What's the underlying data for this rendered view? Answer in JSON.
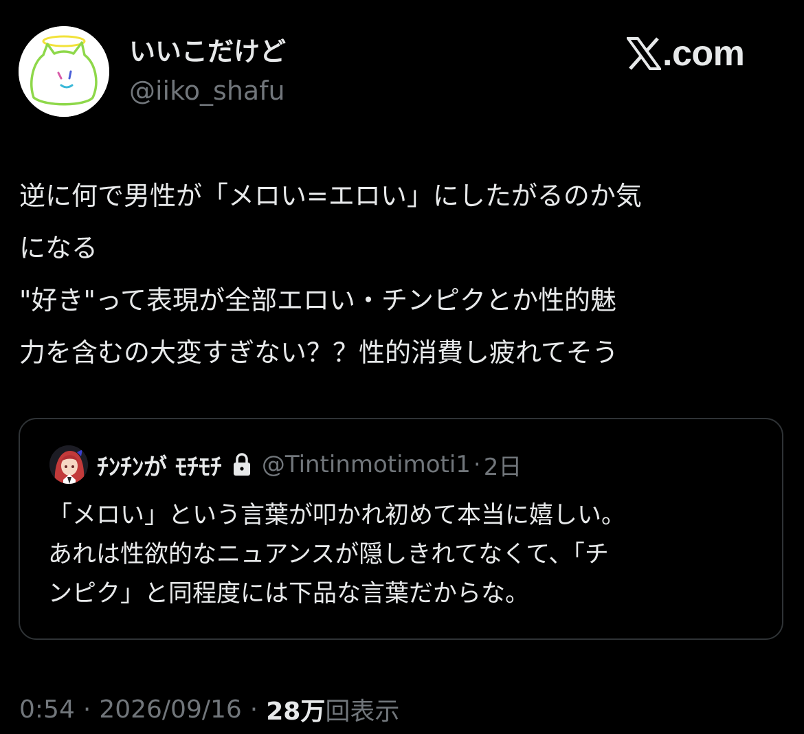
{
  "colors": {
    "background": "#000000",
    "text_primary": "#e7e9ea",
    "text_secondary": "#71767b",
    "border": "#2f3336"
  },
  "author": {
    "display_name": "いいこだけど",
    "handle": "@iiko_shafu",
    "avatar_icon": "cat-halo-avatar"
  },
  "brand": {
    "icon": "x-logo-icon",
    "text": ".com"
  },
  "tweet": {
    "lines": [
      "逆に何で男性が「メロい=エロい」にしたがるのか気",
      "になる",
      "\"好き\"って表現が全部エロい・チンピクとか性的魅",
      "力を含むの大変すぎない？？性的消費し疲れてそう"
    ]
  },
  "quote": {
    "avatar_icon": "red-hair-character-avatar",
    "display_name": "ﾁﾝﾁﾝが ﾓﾁﾓﾁ",
    "lock_icon": "lock-icon",
    "handle": "@Tintinmotimoti1",
    "separator": "·",
    "time": "2日",
    "lines": [
      "「メロい」という言葉が叩かれ初めて本当に嬉しい。",
      "あれは性欲的なニュアンスが隠しきれてなくて、「チ",
      "ンピク」と同程度には下品な言葉だからな。"
    ]
  },
  "meta": {
    "time": "0:54",
    "separator": "·",
    "date": "2026/09/16",
    "views_count": "28万",
    "views_label": "回表示"
  }
}
